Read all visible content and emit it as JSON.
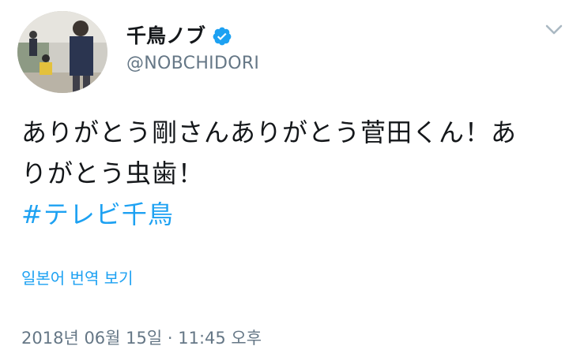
{
  "author": {
    "display_name": "千鳥ノブ",
    "handle": "@NOBCHIDORI",
    "verified_icon": "verified-badge-icon",
    "avatar_icon": "profile-photo"
  },
  "menu": {
    "icon": "chevron-down-icon"
  },
  "tweet": {
    "text_line1": "ありがとう剛さんありがとう菅田くん！あ",
    "text_line2": "りがとう虫歯！",
    "hashtag": "#テレビ千鳥"
  },
  "translate_label": "일본어 번역 보기",
  "timestamp": "2018년 06월 15일 · 11:45 오후",
  "colors": {
    "accent": "#1da1f2",
    "muted": "#657786",
    "text": "#14171a"
  }
}
